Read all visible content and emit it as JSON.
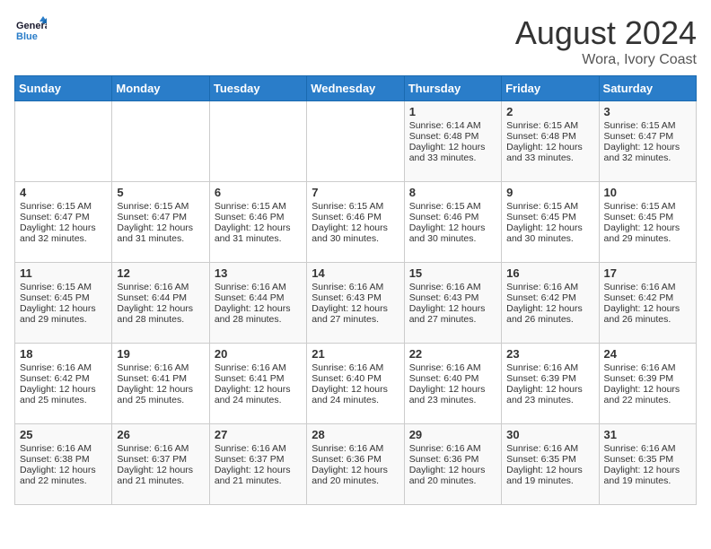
{
  "header": {
    "logo_general": "General",
    "logo_blue": "Blue",
    "title": "August 2024",
    "subtitle": "Wora, Ivory Coast"
  },
  "days_of_week": [
    "Sunday",
    "Monday",
    "Tuesday",
    "Wednesday",
    "Thursday",
    "Friday",
    "Saturday"
  ],
  "weeks": [
    [
      {
        "day": "",
        "lines": []
      },
      {
        "day": "",
        "lines": []
      },
      {
        "day": "",
        "lines": []
      },
      {
        "day": "",
        "lines": []
      },
      {
        "day": "1",
        "lines": [
          "Sunrise: 6:14 AM",
          "Sunset: 6:48 PM",
          "Daylight: 12 hours",
          "and 33 minutes."
        ]
      },
      {
        "day": "2",
        "lines": [
          "Sunrise: 6:15 AM",
          "Sunset: 6:48 PM",
          "Daylight: 12 hours",
          "and 33 minutes."
        ]
      },
      {
        "day": "3",
        "lines": [
          "Sunrise: 6:15 AM",
          "Sunset: 6:47 PM",
          "Daylight: 12 hours",
          "and 32 minutes."
        ]
      }
    ],
    [
      {
        "day": "4",
        "lines": [
          "Sunrise: 6:15 AM",
          "Sunset: 6:47 PM",
          "Daylight: 12 hours",
          "and 32 minutes."
        ]
      },
      {
        "day": "5",
        "lines": [
          "Sunrise: 6:15 AM",
          "Sunset: 6:47 PM",
          "Daylight: 12 hours",
          "and 31 minutes."
        ]
      },
      {
        "day": "6",
        "lines": [
          "Sunrise: 6:15 AM",
          "Sunset: 6:46 PM",
          "Daylight: 12 hours",
          "and 31 minutes."
        ]
      },
      {
        "day": "7",
        "lines": [
          "Sunrise: 6:15 AM",
          "Sunset: 6:46 PM",
          "Daylight: 12 hours",
          "and 30 minutes."
        ]
      },
      {
        "day": "8",
        "lines": [
          "Sunrise: 6:15 AM",
          "Sunset: 6:46 PM",
          "Daylight: 12 hours",
          "and 30 minutes."
        ]
      },
      {
        "day": "9",
        "lines": [
          "Sunrise: 6:15 AM",
          "Sunset: 6:45 PM",
          "Daylight: 12 hours",
          "and 30 minutes."
        ]
      },
      {
        "day": "10",
        "lines": [
          "Sunrise: 6:15 AM",
          "Sunset: 6:45 PM",
          "Daylight: 12 hours",
          "and 29 minutes."
        ]
      }
    ],
    [
      {
        "day": "11",
        "lines": [
          "Sunrise: 6:15 AM",
          "Sunset: 6:45 PM",
          "Daylight: 12 hours",
          "and 29 minutes."
        ]
      },
      {
        "day": "12",
        "lines": [
          "Sunrise: 6:16 AM",
          "Sunset: 6:44 PM",
          "Daylight: 12 hours",
          "and 28 minutes."
        ]
      },
      {
        "day": "13",
        "lines": [
          "Sunrise: 6:16 AM",
          "Sunset: 6:44 PM",
          "Daylight: 12 hours",
          "and 28 minutes."
        ]
      },
      {
        "day": "14",
        "lines": [
          "Sunrise: 6:16 AM",
          "Sunset: 6:43 PM",
          "Daylight: 12 hours",
          "and 27 minutes."
        ]
      },
      {
        "day": "15",
        "lines": [
          "Sunrise: 6:16 AM",
          "Sunset: 6:43 PM",
          "Daylight: 12 hours",
          "and 27 minutes."
        ]
      },
      {
        "day": "16",
        "lines": [
          "Sunrise: 6:16 AM",
          "Sunset: 6:42 PM",
          "Daylight: 12 hours",
          "and 26 minutes."
        ]
      },
      {
        "day": "17",
        "lines": [
          "Sunrise: 6:16 AM",
          "Sunset: 6:42 PM",
          "Daylight: 12 hours",
          "and 26 minutes."
        ]
      }
    ],
    [
      {
        "day": "18",
        "lines": [
          "Sunrise: 6:16 AM",
          "Sunset: 6:42 PM",
          "Daylight: 12 hours",
          "and 25 minutes."
        ]
      },
      {
        "day": "19",
        "lines": [
          "Sunrise: 6:16 AM",
          "Sunset: 6:41 PM",
          "Daylight: 12 hours",
          "and 25 minutes."
        ]
      },
      {
        "day": "20",
        "lines": [
          "Sunrise: 6:16 AM",
          "Sunset: 6:41 PM",
          "Daylight: 12 hours",
          "and 24 minutes."
        ]
      },
      {
        "day": "21",
        "lines": [
          "Sunrise: 6:16 AM",
          "Sunset: 6:40 PM",
          "Daylight: 12 hours",
          "and 24 minutes."
        ]
      },
      {
        "day": "22",
        "lines": [
          "Sunrise: 6:16 AM",
          "Sunset: 6:40 PM",
          "Daylight: 12 hours",
          "and 23 minutes."
        ]
      },
      {
        "day": "23",
        "lines": [
          "Sunrise: 6:16 AM",
          "Sunset: 6:39 PM",
          "Daylight: 12 hours",
          "and 23 minutes."
        ]
      },
      {
        "day": "24",
        "lines": [
          "Sunrise: 6:16 AM",
          "Sunset: 6:39 PM",
          "Daylight: 12 hours",
          "and 22 minutes."
        ]
      }
    ],
    [
      {
        "day": "25",
        "lines": [
          "Sunrise: 6:16 AM",
          "Sunset: 6:38 PM",
          "Daylight: 12 hours",
          "and 22 minutes."
        ]
      },
      {
        "day": "26",
        "lines": [
          "Sunrise: 6:16 AM",
          "Sunset: 6:37 PM",
          "Daylight: 12 hours",
          "and 21 minutes."
        ]
      },
      {
        "day": "27",
        "lines": [
          "Sunrise: 6:16 AM",
          "Sunset: 6:37 PM",
          "Daylight: 12 hours",
          "and 21 minutes."
        ]
      },
      {
        "day": "28",
        "lines": [
          "Sunrise: 6:16 AM",
          "Sunset: 6:36 PM",
          "Daylight: 12 hours",
          "and 20 minutes."
        ]
      },
      {
        "day": "29",
        "lines": [
          "Sunrise: 6:16 AM",
          "Sunset: 6:36 PM",
          "Daylight: 12 hours",
          "and 20 minutes."
        ]
      },
      {
        "day": "30",
        "lines": [
          "Sunrise: 6:16 AM",
          "Sunset: 6:35 PM",
          "Daylight: 12 hours",
          "and 19 minutes."
        ]
      },
      {
        "day": "31",
        "lines": [
          "Sunrise: 6:16 AM",
          "Sunset: 6:35 PM",
          "Daylight: 12 hours",
          "and 19 minutes."
        ]
      }
    ]
  ]
}
